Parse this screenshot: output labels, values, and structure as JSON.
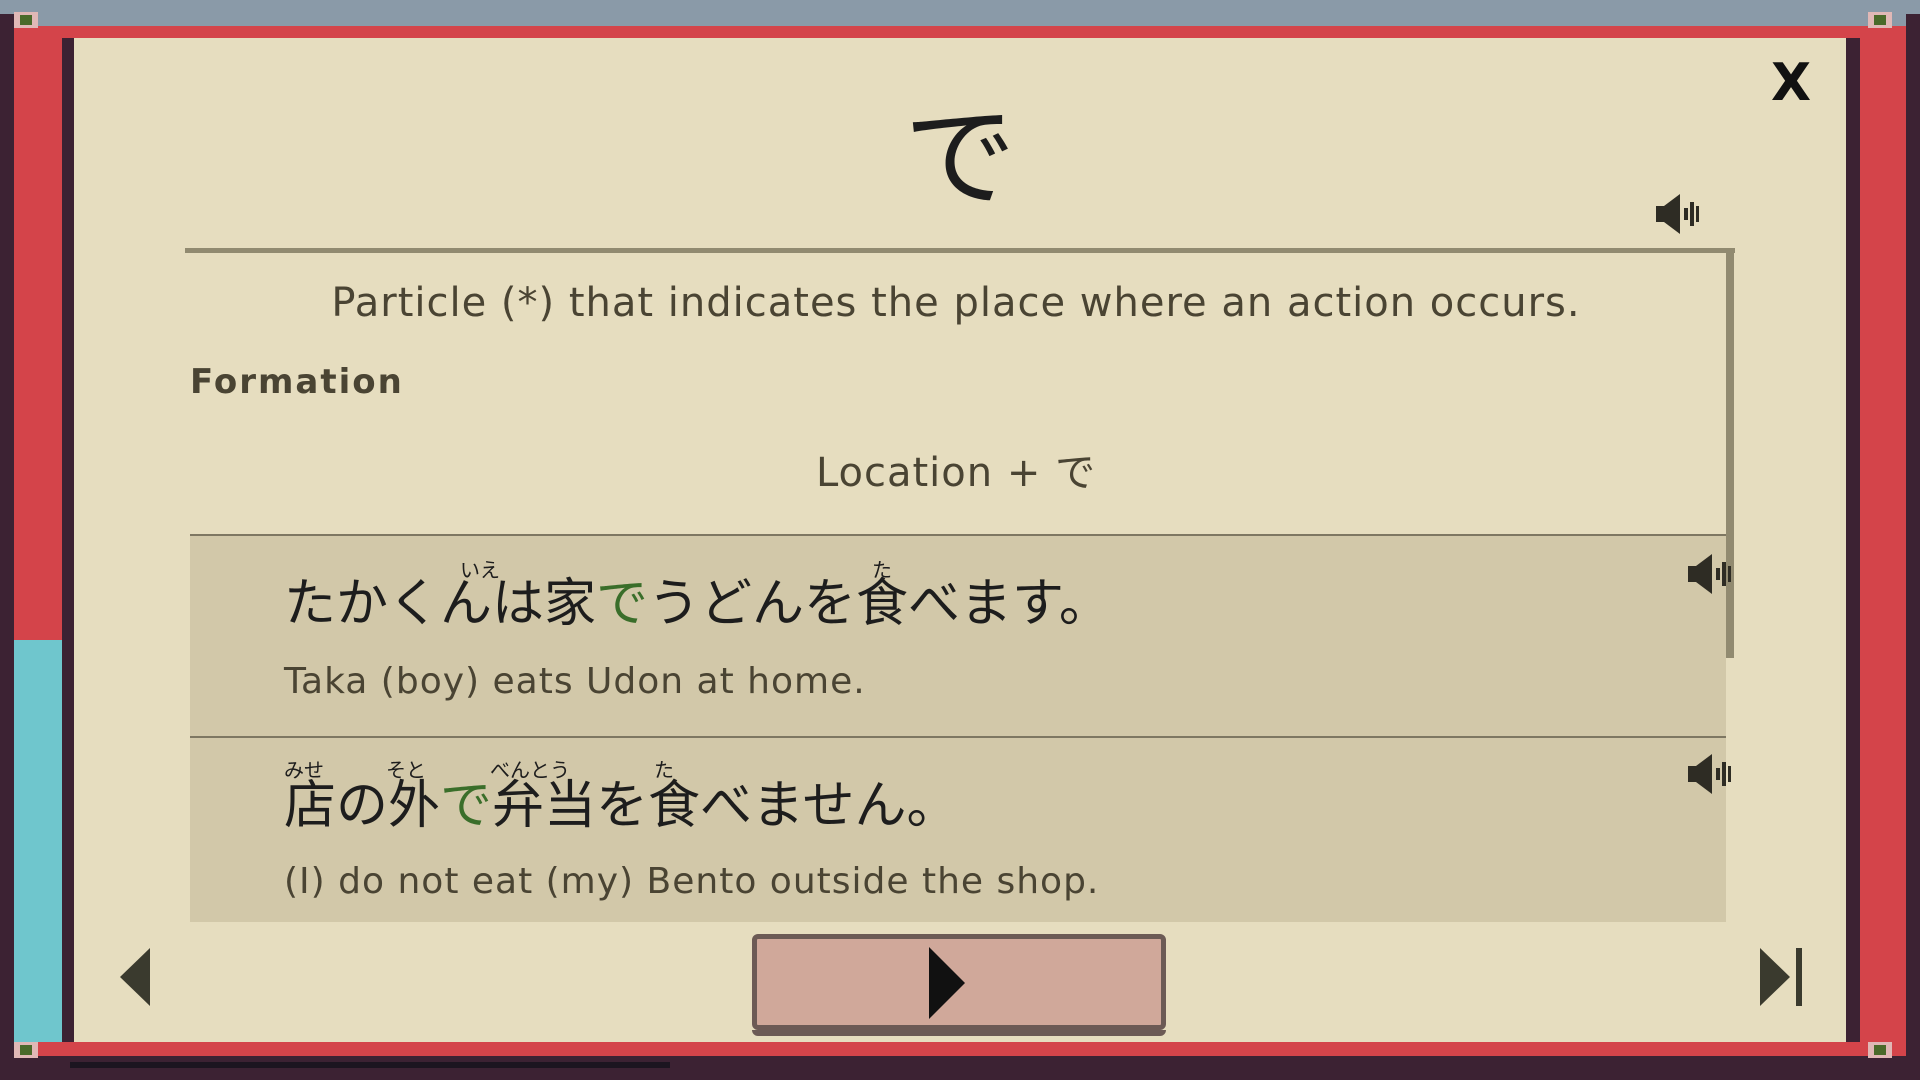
{
  "title": "で",
  "close_label": "X",
  "meaning": "Particle (*) that indicates the place where an action occurs.",
  "formation": {
    "heading": "Formation",
    "text": "Location + で"
  },
  "examples": [
    {
      "jp_before": "たかくんは家",
      "jp_particle": "で",
      "jp_after": "うどんを食べます。",
      "furigana": [
        "いえ",
        "た"
      ],
      "en": "Taka (boy) eats Udon at home."
    },
    {
      "jp_before": "店の外",
      "jp_particle": "で",
      "jp_after": "弁当を食べません。",
      "furigana": [
        "みせ",
        "そと",
        "べんとう",
        "た"
      ],
      "en": "(I) do not eat (my) Bento outside the shop."
    }
  ],
  "icons": {
    "audio": "speaker-icon",
    "prev": "arrow-left-icon",
    "play": "play-icon",
    "last": "skip-to-end-icon",
    "close": "close-icon"
  },
  "colors": {
    "panel_bg": "#e6ddbf",
    "example_bg": "#d2c8a9",
    "frame_red": "#d4444a",
    "frame_teal": "#6fc6cd",
    "frame_dark": "#3c2233",
    "particle_highlight": "#3a6e2a",
    "play_button": "#d0a89a"
  }
}
